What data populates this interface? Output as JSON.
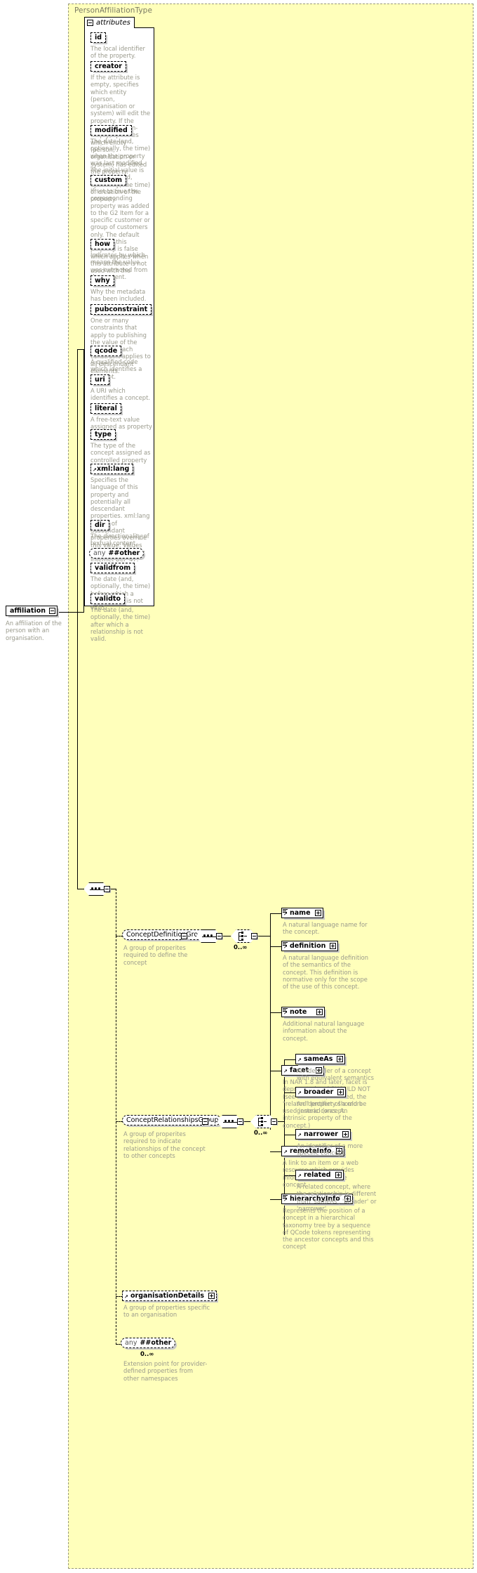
{
  "diagram": {
    "type_name": "PersonAffiliationType",
    "attributes_section_label": "attributes",
    "root_element": {
      "name": "affiliation",
      "annotation": "An affiliation of the person with an organisation."
    },
    "attributes": [
      {
        "name": "id",
        "annotation": "The local identifier of the property."
      },
      {
        "name": "creator",
        "annotation": "If the attribute is empty, specifies which entity (person, organisation or system) will edit the property. If the attribute is non-empty, specifies which entity (person, organisation or system) has edited the property."
      },
      {
        "name": "modified",
        "annotation": "The date (and, optionally, the time) when the property was last modified. The initial value is the date (and, optionally, the time) of creation of the property."
      },
      {
        "name": "custom",
        "annotation": "If set to true the corresponding property was added to the G2 Item for a specific customer or group of customers only. The default value of this property is false which applies when this attribute is not used with the property."
      },
      {
        "name": "how",
        "annotation": "Indicates by which means the value was extracted from the content."
      },
      {
        "name": "why",
        "annotation": "Why the metadata has been included."
      },
      {
        "name": "pubconstraint",
        "annotation": "One or many constraints that apply to publishing the value of the property. Each constraint applies to all descendant elements."
      },
      {
        "name": "qcode",
        "annotation": "A qualified code which identifies a concept."
      },
      {
        "name": "uri",
        "annotation": "A URI which identifies a concept."
      },
      {
        "name": "literal",
        "annotation": "A free-text value assigned as property value."
      },
      {
        "name": "type",
        "annotation": "The type of the concept assigned as controlled property value."
      },
      {
        "name": "xml:lang",
        "annotation": "Specifies the language of this property and potentially all descendant properties. xml:lang values of descendant properties override this value. Values are determined by Internet BCP 47."
      },
      {
        "name": "dir",
        "annotation": "The directionality of textual content."
      },
      {
        "name": "any ##other",
        "any_prefix": "any",
        "any_value": "##other",
        "annotation": ""
      },
      {
        "name": "validfrom",
        "annotation": "The date (and, optionally, the time) before which a relationship is not valid."
      },
      {
        "name": "validto",
        "annotation": "The date (and, optionally, the time) after which a relationship is not valid."
      }
    ],
    "groups": [
      {
        "name": "ConceptDefinitionGroup",
        "annotation": "A group of properites required to define the concept",
        "occurrence": "0..∞",
        "children": [
          {
            "name": "name",
            "annotation": "A natural language name for the concept."
          },
          {
            "name": "definition",
            "annotation": "A natural language definition of the semantics of the concept. This definition is normative only for the scope of the use of this concept."
          },
          {
            "name": "note",
            "annotation": "Additional natural language information about the concept."
          },
          {
            "name": "facet",
            "annotation": "In NAR 1.8 and later, facet is deprecated and SHOULD NOT (see RFC 2119) be used, the \"related\" property should be used instead (was: An intrinsic property of the concept.)"
          },
          {
            "name": "remoteInfo",
            "annotation": "A link to an item or a web resource which provides information about the concept"
          },
          {
            "name": "hierarchyInfo",
            "annotation": "Represents the position of a concept in a hierarchical taxonomy tree by a sequence of QCode tokens representing the ancestor concepts and this concept"
          }
        ]
      },
      {
        "name": "ConceptRelationshipsGroup",
        "annotation": "A group of properites required to indicate relationships of the concept to other concepts",
        "occurrence": "0..∞",
        "children": [
          {
            "name": "sameAs",
            "annotation": "An identifier of a concept with equivalent semantics"
          },
          {
            "name": "broader",
            "annotation": "An identifier of a more generic concept."
          },
          {
            "name": "narrower",
            "annotation": "An identifier of a more specific concept."
          },
          {
            "name": "related",
            "annotation": "A related concept, where the relationship is different from 'sameAs', 'broader' or 'narrower'."
          }
        ]
      }
    ],
    "trailing_elements": [
      {
        "name": "organisationDetails",
        "annotation": "A group of properties specific to an organisation"
      },
      {
        "name": "any ##other",
        "any_prefix": "any",
        "any_value": "##other",
        "occurrence": "0..∞",
        "annotation": "Extension point for provider-defined properties from other namespaces"
      }
    ],
    "colors": {
      "type_background": "#ffffbb",
      "node_background": "#ffffff",
      "annotation_text": "#9a9a8c",
      "line": "#000000",
      "shadow": "#c9c9c9"
    }
  }
}
